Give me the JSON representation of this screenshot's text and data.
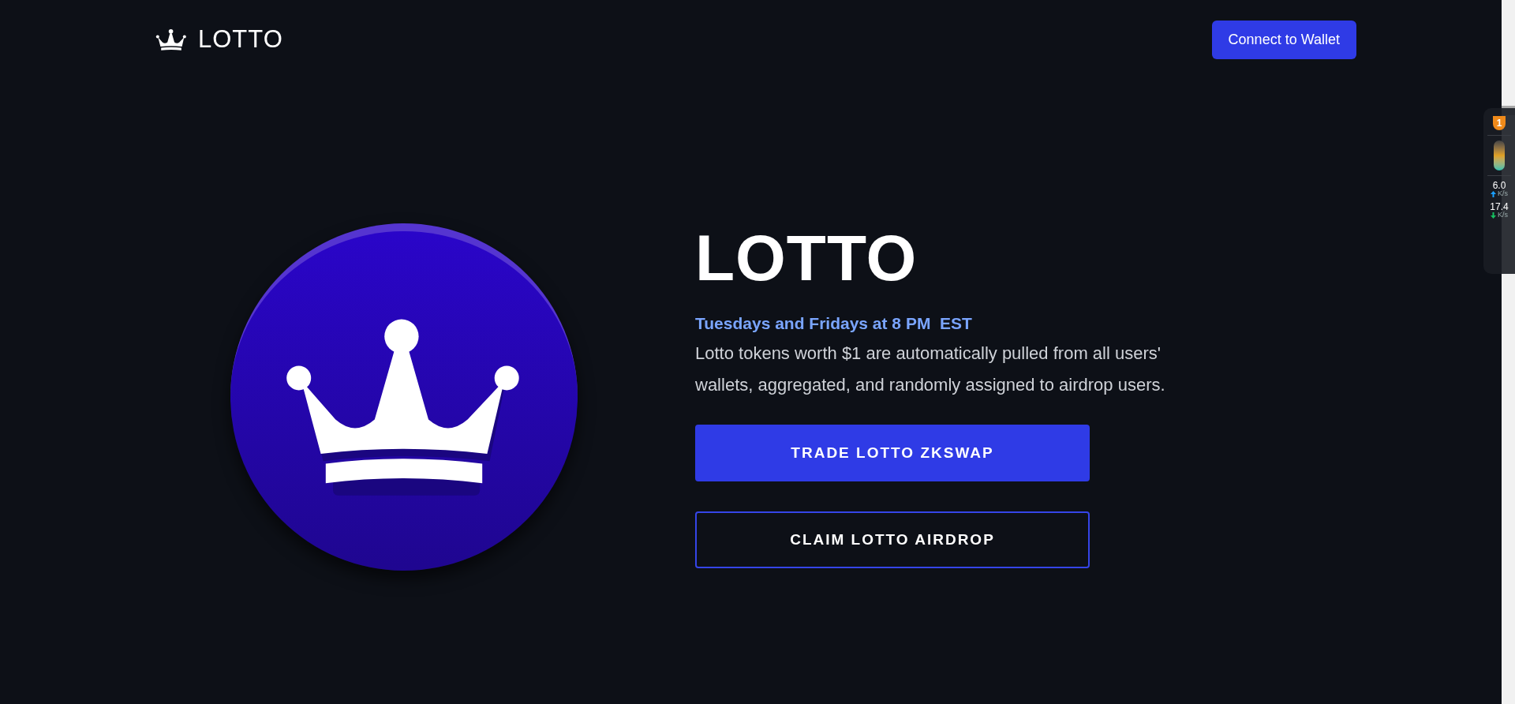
{
  "header": {
    "logo_text": "LOTTO",
    "connect_button": "Connect to Wallet"
  },
  "hero": {
    "title": "LOTTO",
    "schedule": "Tuesdays and Fridays at 8 PM  EST",
    "description": "Lotto tokens worth $1 are automatically pulled from all users' wallets, aggregated, and randomly assigned to airdrop users.",
    "buttons": [
      {
        "label": "TRADE LOTTO ZKSWAP",
        "kind": "filled"
      },
      {
        "label": "CLAIM LOTTO AIRDROP",
        "kind": "outline"
      }
    ]
  },
  "speed_widget": {
    "badge": "1",
    "rates": [
      {
        "value": "6.0",
        "unit": "K/s",
        "kind": "upload"
      },
      {
        "value": "17.4",
        "unit": "K/s",
        "kind": "download"
      }
    ]
  }
}
